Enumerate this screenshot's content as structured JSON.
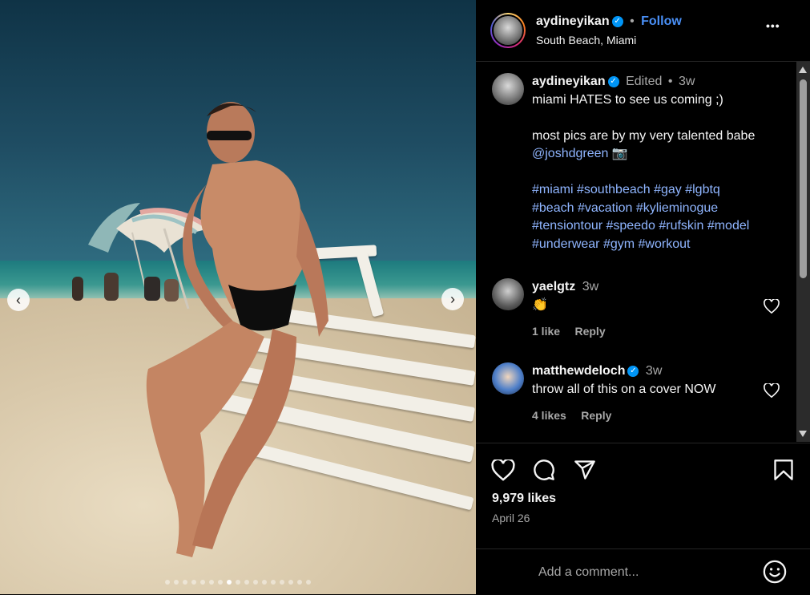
{
  "post": {
    "author": "aydineyikan",
    "location": "South Beach, Miami",
    "follow_label": "Follow",
    "separator": "•",
    "more_label": "•••",
    "edited_label": "Edited",
    "time_ago": "3w",
    "caption_lines": [
      "miami HATES to see us coming ;)",
      "",
      "most pics are by my very talented babe",
      "@joshdgreen 📷"
    ],
    "hashtag_lines": [
      "#miami #southbeach #gay #lgbtq",
      "#beach #vacation #kylieminogue",
      "#tensiontour #speedo #rufskin #model",
      "#underwear #gym #workout"
    ]
  },
  "comments": [
    {
      "user": "yaelgtz",
      "time": "3w",
      "text": "👏",
      "likes": "1 like",
      "reply": "Reply"
    },
    {
      "user": "matthewdeloch",
      "time": "3w",
      "text": "throw all of this on a cover NOW",
      "likes": "4 likes",
      "reply": "Reply"
    }
  ],
  "stats": {
    "likes": "9,979 likes",
    "date": "April 26"
  },
  "composer": {
    "placeholder": "Add a comment..."
  },
  "carousel": {
    "total": 17,
    "active_index": 7
  },
  "colors": {
    "accent_blue": "#0095f6",
    "follow_blue": "#4a90f7",
    "hashtag": "#8fb5ff"
  },
  "icons": {
    "prev": "chevron-left-icon",
    "next": "chevron-right-icon",
    "like": "heart-icon",
    "comment": "comment-icon",
    "share": "send-icon",
    "save": "bookmark-icon",
    "emoji": "emoji-icon"
  }
}
